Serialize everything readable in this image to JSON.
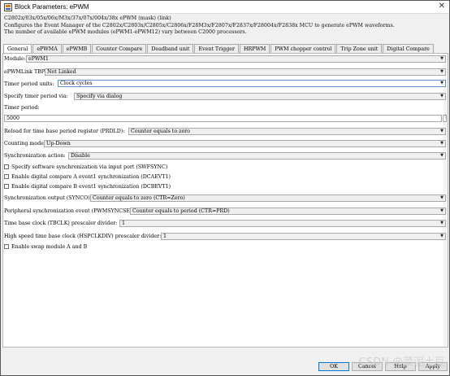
{
  "window": {
    "title": "Block Parameters: ePWM",
    "close_glyph": "✕"
  },
  "description": {
    "subtitle": "C2802x/03x/05x/06x/M3x/37x/07x/004x/38x ePWM (mask) (link)",
    "line1": "Configures the Event Manager of the C2802x/C2803x/C2805x/C2806x/F28M3x/F2807x/F2837x/F28004x/F2838x MCU to generate ePWM waveforms.",
    "line2": "The number of available ePWM modules (ePWM1-ePWM12) vary between C2000 processors."
  },
  "tabs": [
    {
      "label": "General",
      "active": true
    },
    {
      "label": "ePWMA",
      "active": false
    },
    {
      "label": "ePWMB",
      "active": false
    },
    {
      "label": "Counter Compare",
      "active": false
    },
    {
      "label": "Deadband unit",
      "active": false
    },
    {
      "label": "Event Trigger",
      "active": false
    },
    {
      "label": "HRPWM",
      "active": false
    },
    {
      "label": "PWM chopper control",
      "active": false
    },
    {
      "label": "Trip Zone unit",
      "active": false
    },
    {
      "label": "Digital Compare",
      "active": false
    }
  ],
  "params": {
    "module": {
      "label": "Module:",
      "value": "ePWM1"
    },
    "epwmlink": {
      "label": "ePWMLink TBPRD",
      "value": "Not Linked"
    },
    "timer_units": {
      "label": "Timer period units:",
      "value": "Clock cycles"
    },
    "specify_timer": {
      "label": "Specify timer period via:",
      "value": "Specify via dialog"
    },
    "timer_period": {
      "label": "Timer period:",
      "value": "5000",
      "more_glyph": "⋮"
    },
    "reload": {
      "label": "Reload for time base period register (PRDLD):",
      "value": "Counter equals to zero"
    },
    "counting_mode": {
      "label": "Counting mode:",
      "value": "Up-Down"
    },
    "sync_action": {
      "label": "Synchronization action:",
      "value": "Disable"
    },
    "cb_swfsync": {
      "label": "Specify software synchronization via input port (SWFSYNC)",
      "checked": false
    },
    "cb_dcaevt1": {
      "label": "Enable digital compare A event1 synchronization (DCAEVT1)",
      "checked": false
    },
    "cb_dcbevt1": {
      "label": "Enable digital compare B event1 synchronization (DCBEVT1)",
      "checked": false
    },
    "sync_output": {
      "label": "Synchronization output (SYNCO):",
      "value": "Counter equals to zero (CTR=Zero)"
    },
    "peripheral_sync": {
      "label": "Peripheral synchronization event (PWMSYNCSEL):",
      "value": "Counter equals to period (CTR=PRD)"
    },
    "tbclk": {
      "label": "Time base clock (TBCLK) prescaler divider:",
      "value": "1"
    },
    "hspclkdiv": {
      "label": "High speed time base clock (HSPCLKDIV) prescaler divider:",
      "value": "1"
    },
    "cb_swap": {
      "label": "Enable swap module A and B",
      "checked": false
    }
  },
  "dropdown_arrow": "▼",
  "buttons": {
    "ok": "OK",
    "cancel": "Cancel",
    "help": "Help",
    "apply": "Apply"
  },
  "watermark": "CSDN @菜泥土豆"
}
